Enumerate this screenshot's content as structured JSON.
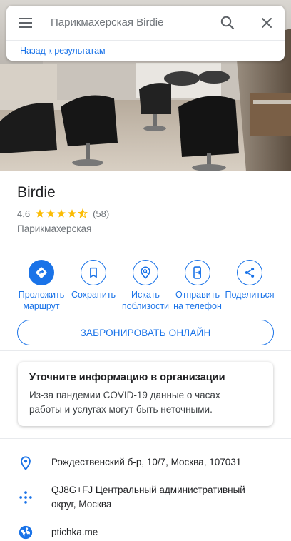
{
  "search": {
    "query": "Парикмахерская Birdie",
    "back_label": "Назад к результатам"
  },
  "place": {
    "name": "Birdie",
    "rating": "4,6",
    "stars": 4.6,
    "reviews": "(58)",
    "category": "Парикмахерская"
  },
  "actions": [
    {
      "line1": "Проложить",
      "line2": "маршрут"
    },
    {
      "line1": "Сохранить",
      "line2": ""
    },
    {
      "line1": "Искать",
      "line2": "поблизости"
    },
    {
      "line1": "Отправить",
      "line2": "на телефон"
    },
    {
      "line1": "Поделиться",
      "line2": ""
    }
  ],
  "booking": {
    "label": "ЗАБРОНИРОВАТЬ ОНЛАЙН"
  },
  "notice": {
    "title": "Уточните информацию в организации",
    "line1": "Из-за пандемии COVID-19 данные о часах",
    "line2": "работы и услугах могут быть неточными."
  },
  "details": {
    "address": "Рождественский б-р, 10/7, Москва, 107031",
    "plus_code_line1": "QJ8G+FJ Центральный административный",
    "plus_code_line2": "округ, Москва",
    "website": "ptichka.me"
  },
  "colors": {
    "accent": "#1a73e8",
    "star": "#fbbc04",
    "secondary_text": "#70757a"
  }
}
